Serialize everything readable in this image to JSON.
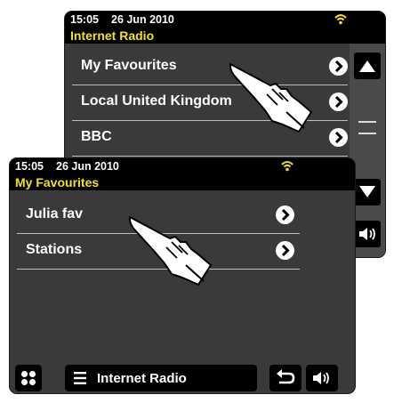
{
  "back_screen": {
    "status": {
      "time": "15:05",
      "date": "26 Jun 2010"
    },
    "title": "Internet Radio",
    "items": [
      {
        "label": "My Favourites"
      },
      {
        "label": "Local United Kingdom"
      },
      {
        "label": "BBC"
      }
    ]
  },
  "front_screen": {
    "status": {
      "time": "15:05",
      "date": "26 Jun 2010"
    },
    "title": "My Favourites",
    "items": [
      {
        "label": "Julia fav"
      },
      {
        "label": "Stations"
      }
    ],
    "bottom_bar": {
      "mode_label": "Internet Radio"
    }
  },
  "colors": {
    "title_text": "#f2e21b",
    "screen_bg": "#3a3a3a",
    "bar_bg": "#000000",
    "wifi": "#f2e21b"
  },
  "icons": [
    "wifi-icon",
    "chevron-right-icon",
    "scroll-up-icon",
    "scroll-down-icon",
    "volume-icon",
    "grid-menu-icon",
    "list-menu-icon",
    "back-icon",
    "pointing-hand-icon"
  ]
}
